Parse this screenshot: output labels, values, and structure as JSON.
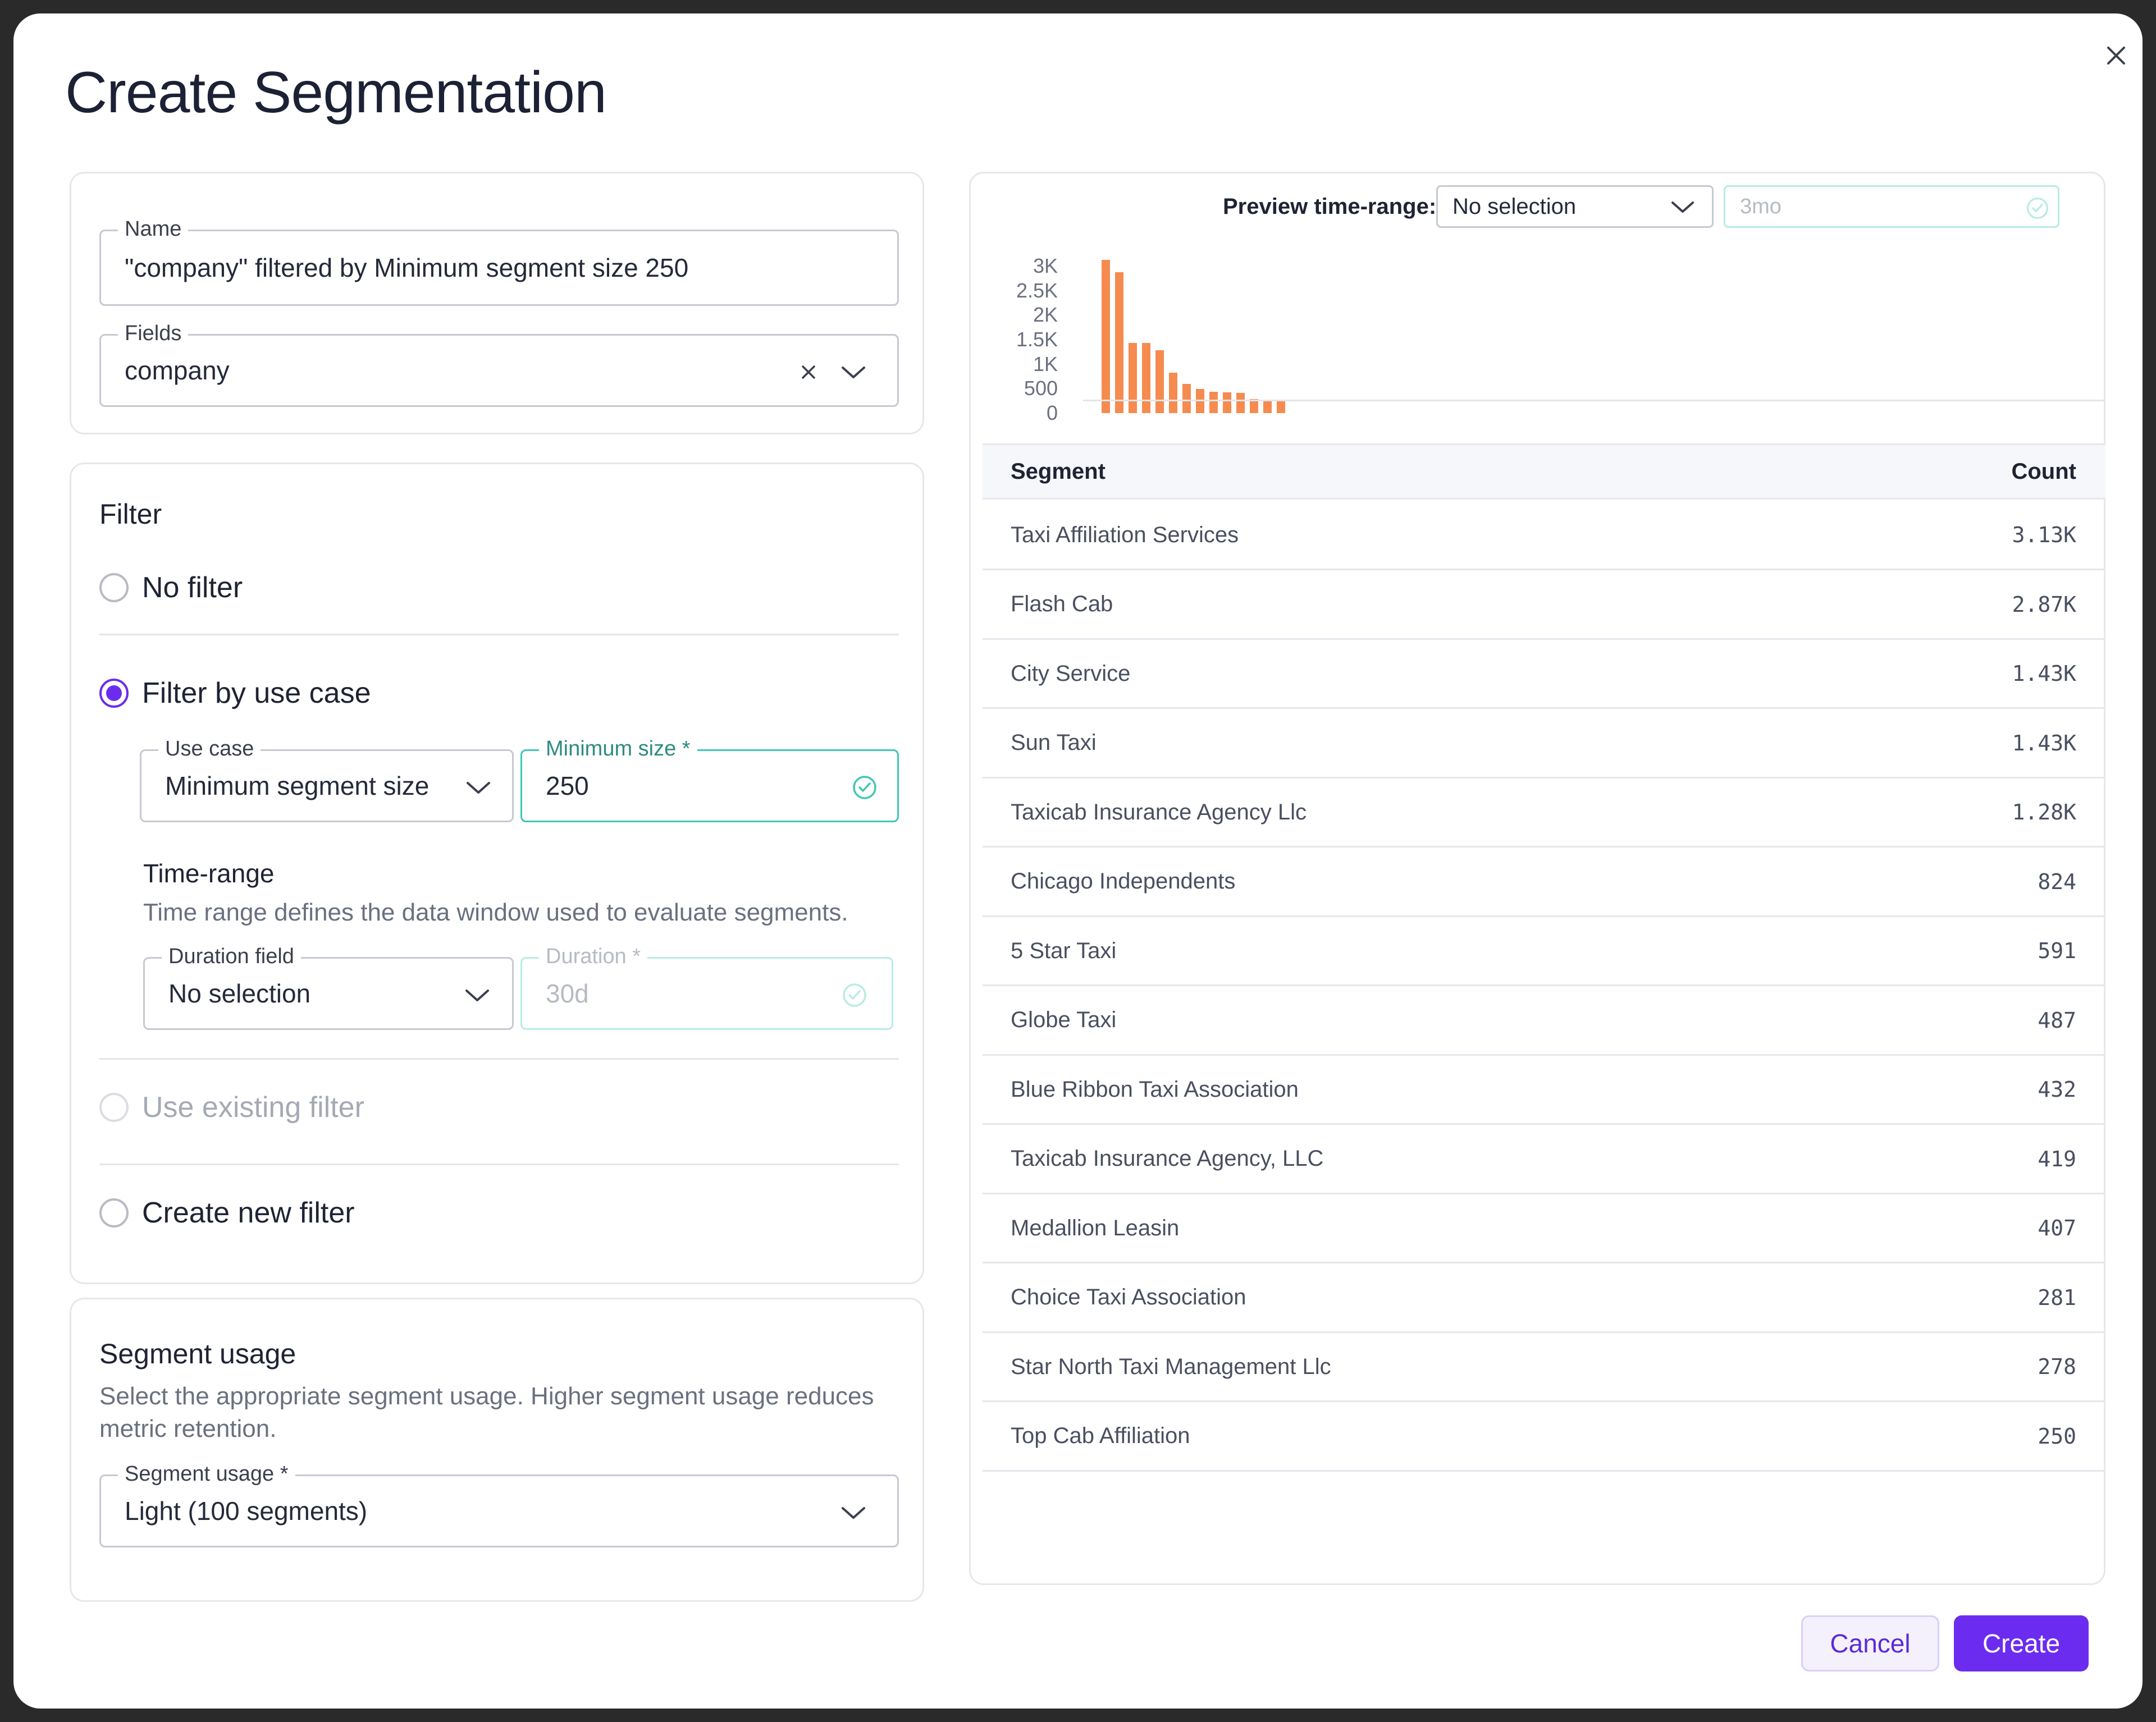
{
  "dialog": {
    "title": "Create Segmentation"
  },
  "general": {
    "name_label": "Name",
    "name_value": "\"company\" filtered by Minimum segment size 250",
    "fields_label": "Fields",
    "fields_value": "company"
  },
  "filter": {
    "heading": "Filter",
    "options": {
      "no_filter": "No filter",
      "by_use_case": "Filter by use case",
      "use_existing": "Use existing filter",
      "create_new": "Create new filter"
    },
    "selected": "by_use_case",
    "use_case_label": "Use case",
    "use_case_value": "Minimum segment size",
    "min_size_label": "Minimum size *",
    "min_size_value": "250",
    "time_range_heading": "Time-range",
    "time_range_desc": "Time range defines the data window used to evaluate segments.",
    "duration_field_label": "Duration field",
    "duration_field_value": "No selection",
    "duration_label": "Duration *",
    "duration_value": "30d"
  },
  "segment_usage": {
    "heading": "Segment usage",
    "desc_line1": "Select the appropriate segment usage. Higher segment usage reduces",
    "desc_line2": "metric retention.",
    "select_label": "Segment usage *",
    "select_value": "Light (100 segments)"
  },
  "preview": {
    "label": "Preview time-range:",
    "select_value": "No selection",
    "range_value": "3mo"
  },
  "chart_data": {
    "type": "bar",
    "yticks": [
      "3K",
      "2.5K",
      "2K",
      "1.5K",
      "1K",
      "500",
      "0"
    ],
    "ylim": [
      0,
      3000
    ],
    "values": [
      3130,
      2870,
      1430,
      1430,
      1280,
      824,
      591,
      487,
      432,
      419,
      407,
      281,
      278,
      250
    ]
  },
  "table": {
    "col_segment": "Segment",
    "col_count": "Count",
    "rows": [
      {
        "segment": "Taxi Affiliation Services",
        "count": "3.13K"
      },
      {
        "segment": "Flash Cab",
        "count": "2.87K"
      },
      {
        "segment": "City Service",
        "count": "1.43K"
      },
      {
        "segment": "Sun Taxi",
        "count": "1.43K"
      },
      {
        "segment": "Taxicab Insurance Agency Llc",
        "count": "1.28K"
      },
      {
        "segment": "Chicago Independents",
        "count": "824"
      },
      {
        "segment": "5 Star Taxi",
        "count": "591"
      },
      {
        "segment": "Globe Taxi",
        "count": "487"
      },
      {
        "segment": "Blue Ribbon Taxi Association",
        "count": "432"
      },
      {
        "segment": "Taxicab Insurance Agency, LLC",
        "count": "419"
      },
      {
        "segment": "Medallion Leasin",
        "count": "407"
      },
      {
        "segment": "Choice Taxi Association",
        "count": "281"
      },
      {
        "segment": "Star North Taxi Management Llc",
        "count": "278"
      },
      {
        "segment": "Top Cab Affiliation",
        "count": "250"
      }
    ]
  },
  "actions": {
    "cancel": "Cancel",
    "create": "Create"
  },
  "colors": {
    "accent": "#6b2cf0",
    "bar": "#f58b4f",
    "valid": "#3fc7b4"
  }
}
